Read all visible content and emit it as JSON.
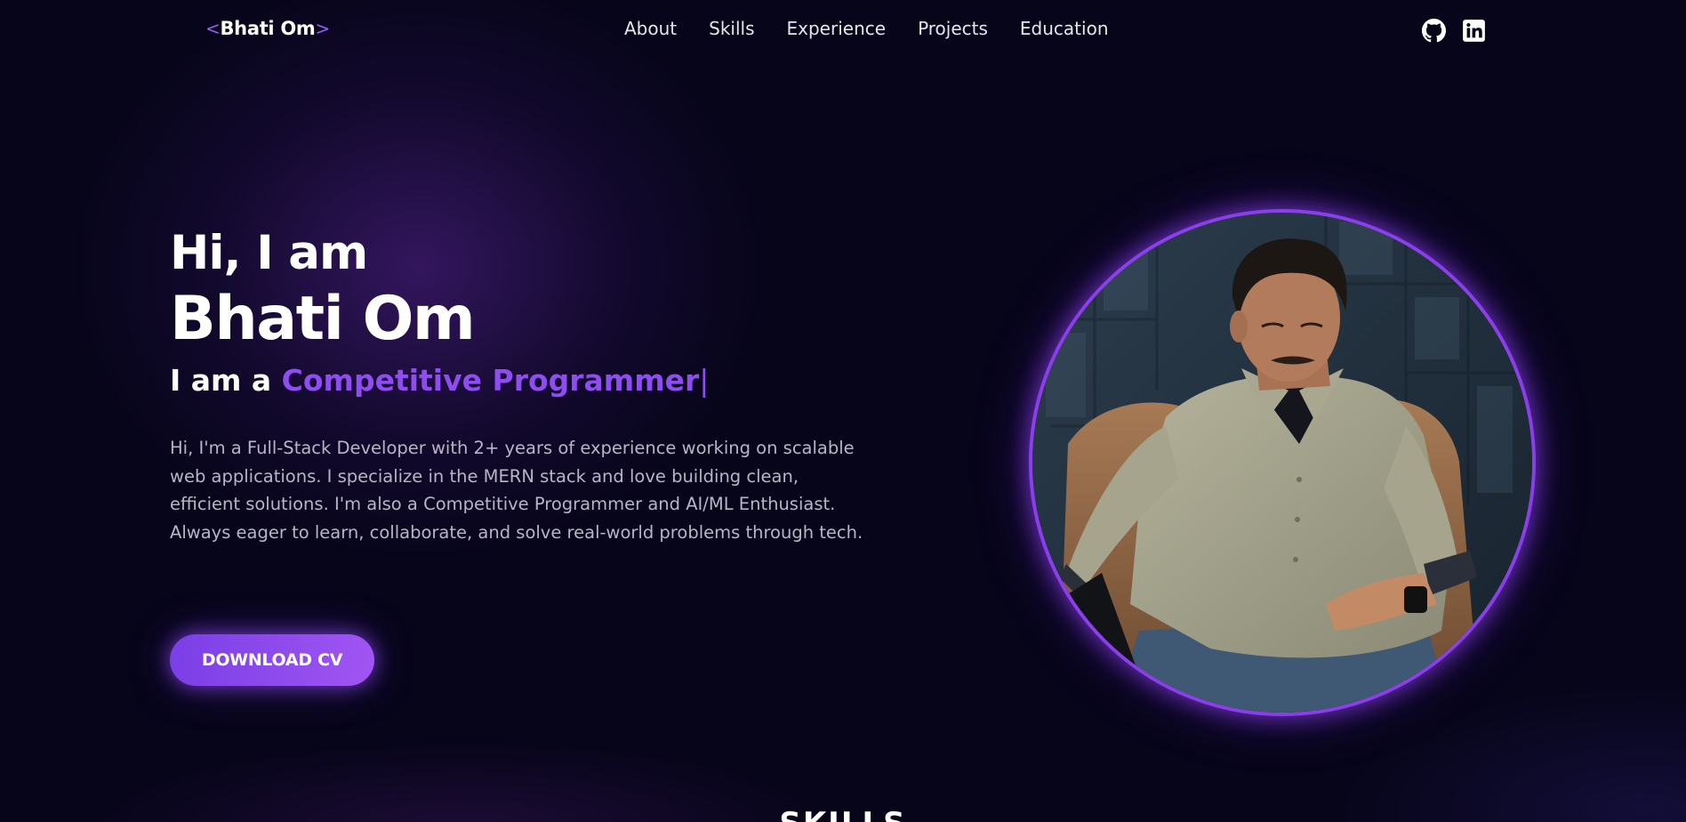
{
  "nav": {
    "logo": {
      "open_bracket": "<",
      "text": "Bhati Om",
      "close_bracket": ">"
    },
    "links": [
      "About",
      "Skills",
      "Experience",
      "Projects",
      "Education"
    ],
    "social_icons": [
      "github-icon",
      "linkedin-icon"
    ]
  },
  "hero": {
    "greeting": "Hi, I am",
    "name": "Bhati Om",
    "role_prefix": "I am a ",
    "role_typed": "Competitive Programmer",
    "caret": "|",
    "description": "Hi, I'm a Full-Stack Developer with 2+ years of experience working on scalable web applications. I specialize in the MERN stack and love building clean, efficient solutions. I'm also a Competitive Programmer and AI/ML Enthusiast. Always eager to learn, collaborate, and solve real-world problems through tech.",
    "cta_label": "DOWNLOAD CV"
  },
  "next_section": {
    "heading": "SKILLS"
  },
  "colors": {
    "background": "#07051a",
    "accent": "#8f4cf0",
    "accent_light": "#a155f2",
    "text_muted": "#b8b5c6"
  }
}
